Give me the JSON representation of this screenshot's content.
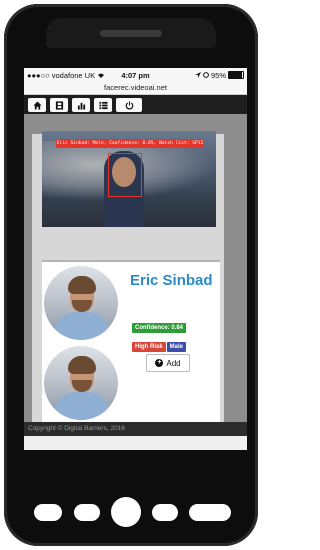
{
  "status_bar": {
    "carrier": "●●●○○ vodafone UK",
    "time": "4:07 pm",
    "battery": "95%",
    "battery_level": 0.95
  },
  "browser": {
    "url": "facerec.videoai.net"
  },
  "nav": {
    "items": [
      {
        "icon": "home-icon"
      },
      {
        "icon": "film-icon"
      },
      {
        "icon": "bar-chart-icon"
      },
      {
        "icon": "list-icon"
      },
      {
        "icon": "power-icon"
      }
    ]
  },
  "detection": {
    "overlay_text": "Eric Sinbad: Male, Confidence: 0.85, Watch list: SP12"
  },
  "match": {
    "name": "Eric Sinbad",
    "confidence_label": "Confidence: 0.84",
    "risk_label": "High Risk",
    "gender_label": "Male",
    "add_label": "Add"
  },
  "footer": {
    "copyright": "Copyright © Digital Barriers, 2016"
  },
  "colors": {
    "accent_name": "#2b8bc7",
    "confidence": "#2f9b39",
    "risk": "#d8453b",
    "gender": "#3c4ea8",
    "overlay": "#e5342a"
  }
}
